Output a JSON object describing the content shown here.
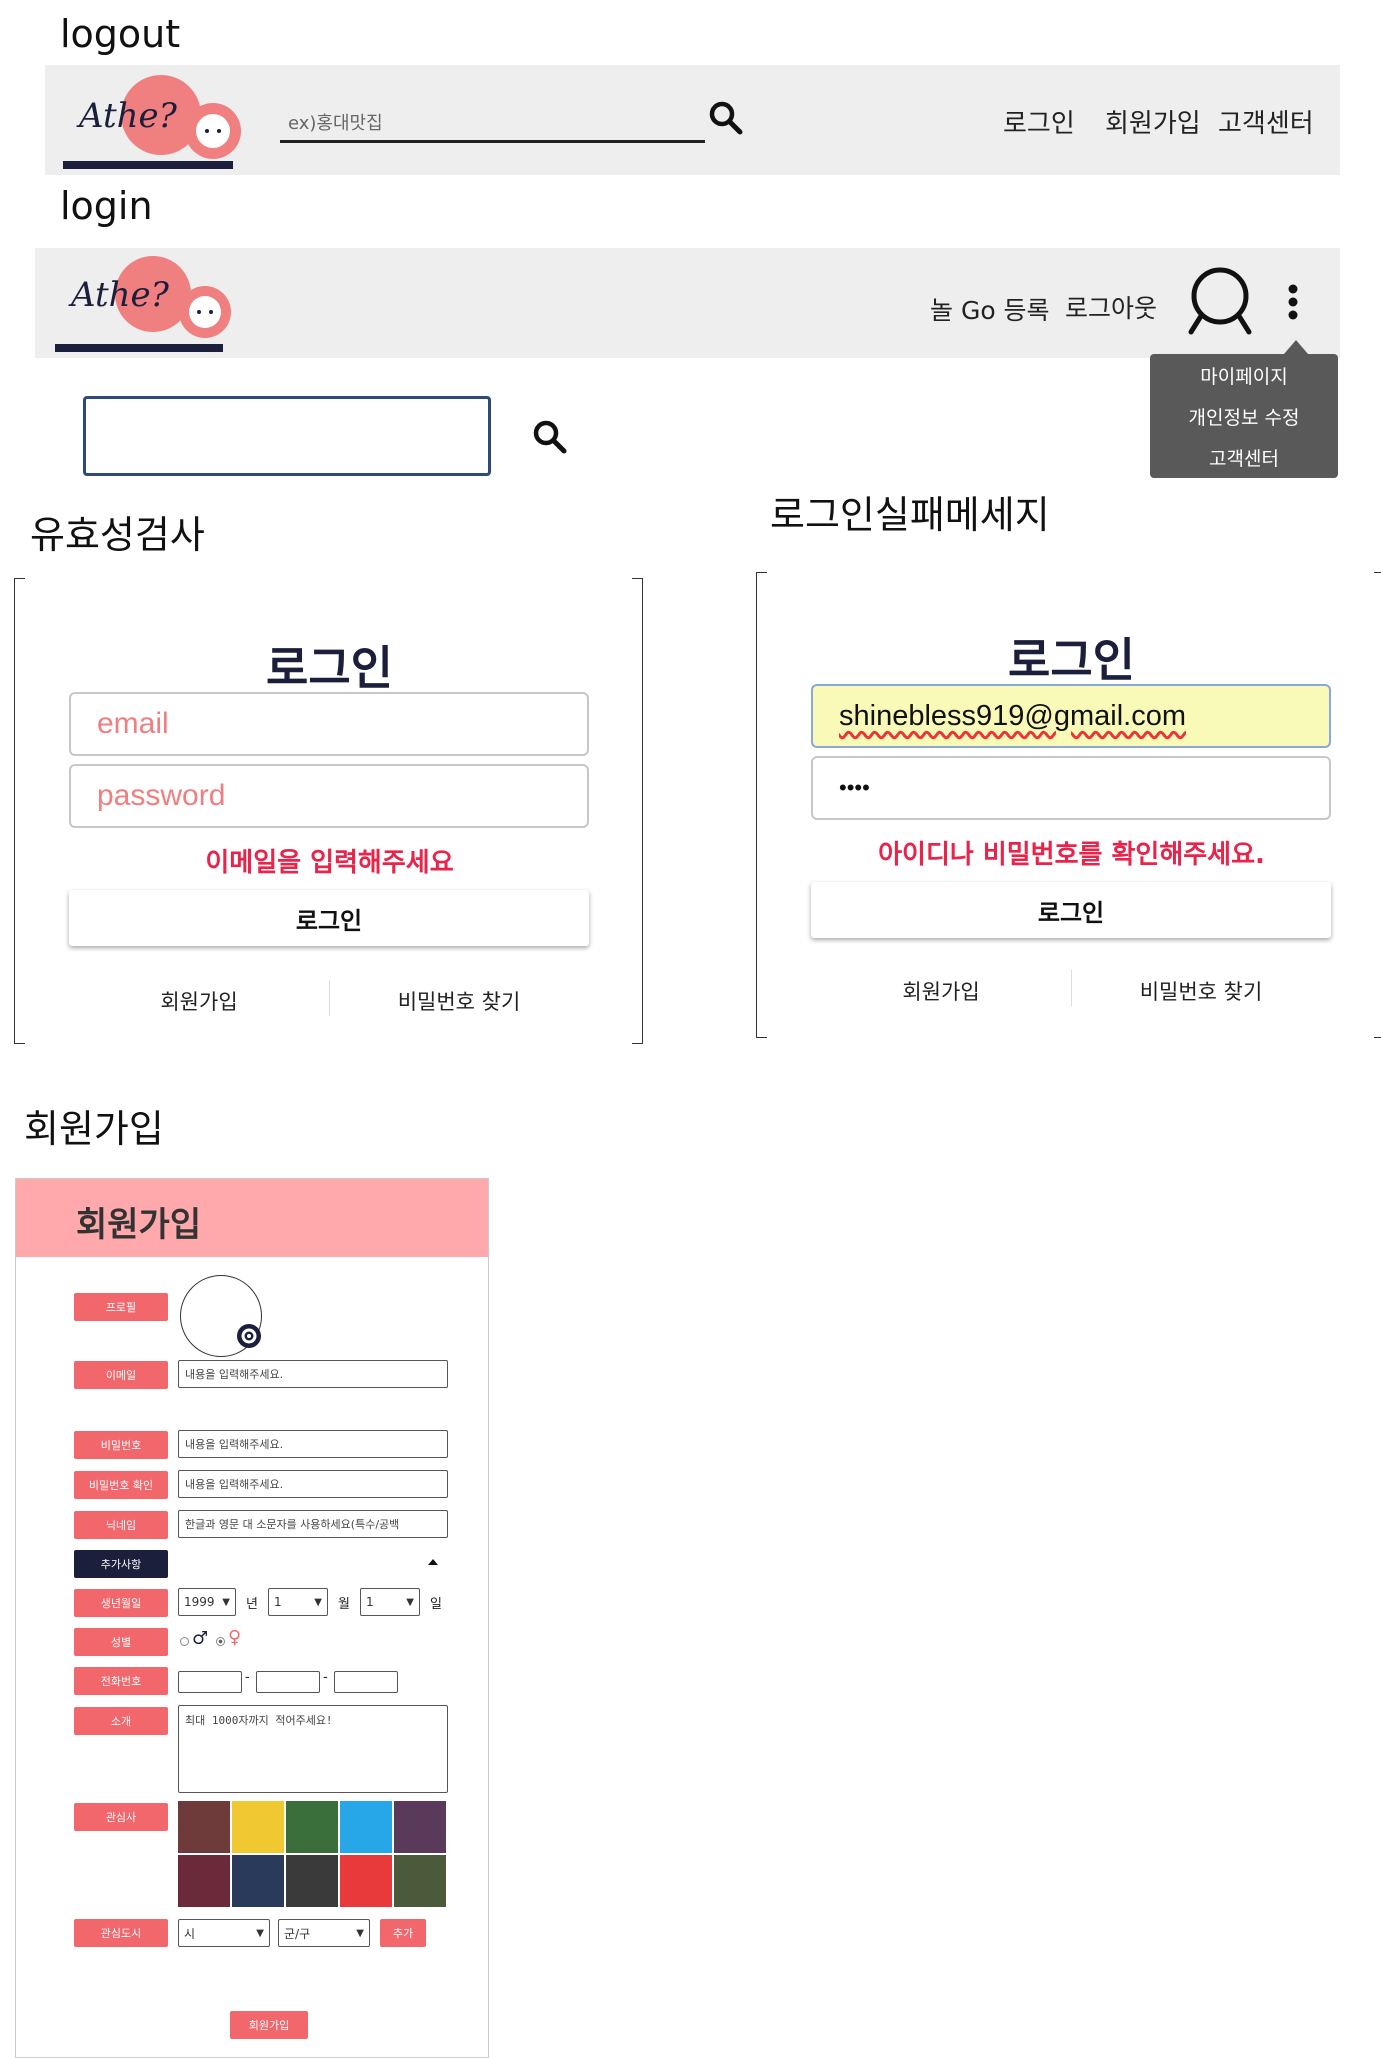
{
  "sections": {
    "logout": "logout",
    "login": "login",
    "validation": "유효성검사",
    "login_fail": "로그인실패메세지",
    "signup": "회원가입"
  },
  "logo": {
    "text": "Athe?",
    "go": "Go"
  },
  "header_logout": {
    "search_placeholder": "ex)홍대맛집",
    "links": [
      "로그인",
      "회원가입",
      "고객센터"
    ]
  },
  "header_login": {
    "links": [
      "놀 Go 등록",
      "로그아웃"
    ],
    "dropdown": [
      "마이페이지",
      "개인정보 수정",
      "고객센터"
    ]
  },
  "login_validation": {
    "title": "로그인",
    "email_placeholder": "email",
    "password_placeholder": "password",
    "error": "이메일을 입력해주세요",
    "button": "로그인",
    "signup_link": "회원가입",
    "find_password_link": "비밀번호 찾기"
  },
  "login_fail": {
    "title": "로그인",
    "email_value": "shinebless919@gmail.com",
    "password_value": "••••",
    "error": "아이디나 비밀번호를 확인해주세요.",
    "button": "로그인",
    "signup_link": "회원가입",
    "find_password_link": "비밀번호 찾기"
  },
  "signup_form": {
    "title": "회원가입",
    "labels": {
      "profile": "프로필",
      "email": "이메일",
      "password": "비밀번호",
      "password_confirm": "비밀번호 확인",
      "nickname": "닉네임",
      "extra": "추가사항",
      "birth": "생년월일",
      "gender": "성별",
      "phone": "전화번호",
      "intro": "소개",
      "interests": "관심사",
      "city": "관심도시"
    },
    "placeholders": {
      "email": "내용을 입력해주세요.",
      "password": "내용을 입력해주세요.",
      "password_confirm": "내용을 입력해주세요.",
      "nickname": "한글과 영문 대 소문자를 사용하세요(특수/공백",
      "intro": "최대 1000자까지 적어주세요!"
    },
    "birth": {
      "year": "1999",
      "year_unit": "년",
      "month": "1",
      "month_unit": "월",
      "day": "1",
      "day_unit": "일"
    },
    "gender": {
      "male": "♂",
      "female": "♀"
    },
    "phone_sep": "-",
    "city": {
      "si": "시",
      "gu": "군/구",
      "add": "추가"
    },
    "submit": "회원가입"
  },
  "colors": {
    "nav_bg": "#eeeeee",
    "accent_pink": "#f2676c",
    "title_navy": "#1b1f3b",
    "error_red": "#e8244b",
    "signup_header": "#ffa9ac"
  }
}
